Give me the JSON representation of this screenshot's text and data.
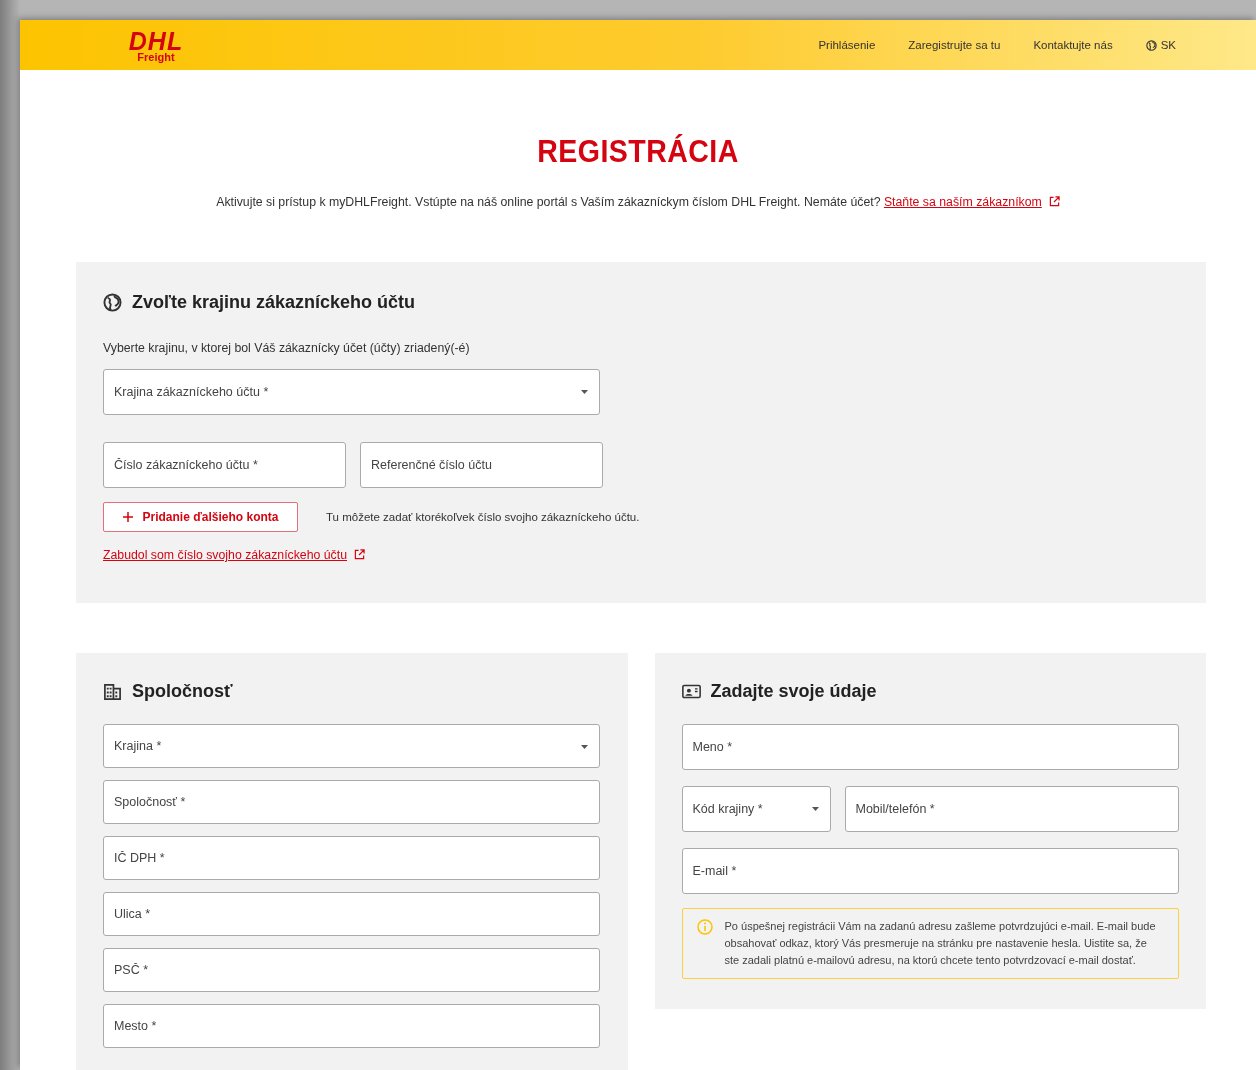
{
  "header": {
    "logo": {
      "wordmark": "DHL",
      "sub": "Freight"
    },
    "nav": [
      {
        "label": "Prihlásenie",
        "kind": "link"
      },
      {
        "label": "Zaregistrujte sa tu",
        "kind": "link"
      },
      {
        "label": "Kontaktujte nás",
        "kind": "link"
      },
      {
        "label": "SK",
        "kind": "language"
      }
    ]
  },
  "title": "REGISTRÁCIA",
  "intro": {
    "text": "Aktivujte si prístup k myDHLFreight. Vstúpte na náš online portál s Vaším zákazníckym číslom DHL Freight. Nemáte účet?",
    "link": "Staňte sa naším zákazníkom"
  },
  "account_section": {
    "heading": "Zvoľte krajinu zákazníckeho účtu",
    "description": "Vyberte krajinu, v ktorej bol Váš zákaznícky účet (účty) zriadený(-é)",
    "rows": [
      [
        {
          "kind": "select",
          "placeholder": "Krajina zákazníckeho účtu *"
        }
      ],
      [
        {
          "kind": "text",
          "placeholder": "Číslo zákazníckeho účtu *"
        },
        {
          "kind": "text",
          "placeholder": "Referenčné číslo účtu"
        }
      ]
    ],
    "add_button": "Pridanie ďalšieho konta",
    "add_note": "Tu môžete zadať ktorékoľvek číslo svojho zákazníckeho účtu.",
    "forgot_link": "Zabudol som číslo svojho zákazníckeho účtu"
  },
  "company_section": {
    "heading": "Spoločnosť",
    "rows": [
      [
        {
          "kind": "select",
          "placeholder": "Krajina *"
        }
      ],
      [
        {
          "kind": "text",
          "placeholder": "Spoločnosť *"
        }
      ],
      [
        {
          "kind": "text",
          "placeholder": "IČ DPH *"
        }
      ],
      [
        {
          "kind": "text",
          "placeholder": "Ulica *"
        }
      ],
      [
        {
          "kind": "text",
          "placeholder": "PSČ *"
        }
      ],
      [
        {
          "kind": "text",
          "placeholder": "Mesto *"
        }
      ]
    ]
  },
  "personal_section": {
    "heading": "Zadajte svoje údaje",
    "rows": [
      [
        {
          "kind": "text",
          "placeholder": "Meno *"
        }
      ],
      [
        {
          "kind": "select",
          "placeholder": "Kód krajiny *"
        },
        {
          "kind": "text",
          "placeholder": "Mobil/telefón *"
        }
      ],
      [
        {
          "kind": "text",
          "placeholder": "E-mail *"
        }
      ]
    ],
    "info": "Po úspešnej registrácii Vám na zadanú adresu zašleme potvrdzujúci e-mail. E-mail bude obsahovať odkaz, ktorý Vás presmeruje na stránku pre nastavenie hesla. Uistite sa, že ste zadali platnú e-mailovú adresu, na ktorú chcete tento potvrdzovací e-mail dostať."
  }
}
